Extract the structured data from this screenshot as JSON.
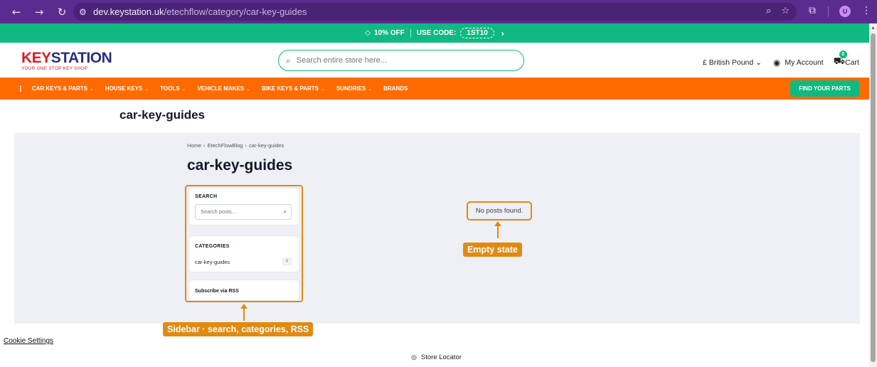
{
  "browser": {
    "url_host": "dev.keystation.uk",
    "url_path": "/etechflow/category/car-key-guides",
    "profile_initial": "U",
    "icons": [
      "back-icon",
      "forward-icon",
      "reload-icon",
      "site-info-icon",
      "zoom-icon",
      "star-icon",
      "extensions-icon",
      "menu-icon"
    ]
  },
  "promo": {
    "discount": "10% OFF",
    "use_code_label": "USE CODE:",
    "code": "1ST10",
    "arrow": "›"
  },
  "header": {
    "logo_key": "KEY",
    "logo_station": "STATION",
    "logo_tagline": "YOUR ONE STOP KEY SHOP",
    "search_placeholder": "Search entire store here...",
    "currency": "£ British Pound ⌄",
    "account": "My Account",
    "cart_label": "Cart",
    "cart_count": "0"
  },
  "nav": {
    "items": [
      {
        "label": "CAR KEYS & PARTS",
        "dropdown": true
      },
      {
        "label": "HOUSE KEYS",
        "dropdown": true
      },
      {
        "label": "TOOLS",
        "dropdown": true
      },
      {
        "label": "VEHICLE MAKES",
        "dropdown": true
      },
      {
        "label": "BIKE KEYS & PARTS",
        "dropdown": true
      },
      {
        "label": "SUNDRIES",
        "dropdown": true
      },
      {
        "label": "BRANDS",
        "dropdown": false
      }
    ],
    "find_parts": "FIND YOUR PARTS"
  },
  "page": {
    "heading": "car-key-guides",
    "breadcrumb": [
      "Home",
      "EtechFlowBlog",
      "car-key-guides"
    ],
    "blog_title": "car-key-guides"
  },
  "sidebar": {
    "search_title": "SEARCH",
    "search_placeholder": "Search posts...",
    "categories_title": "CATEGORIES",
    "categories": [
      {
        "name": "car-key-guides",
        "count": "0"
      }
    ],
    "rss_label": "Subscribe via RSS"
  },
  "main": {
    "empty_message": "No posts found."
  },
  "annotations": {
    "empty_state": "Empty state",
    "sidebar": "Sidebar · search, categories, RSS"
  },
  "footer": {
    "cookie_settings": "Cookie Settings",
    "store_locator": "Store Locator"
  },
  "colors": {
    "browser_chrome": "#5b2c8f",
    "promo_green": "#10b981",
    "nav_orange": "#ff6b00",
    "annotation_orange": "#e08a12",
    "logo_red": "#dc1c24",
    "logo_navy": "#2a2f86"
  }
}
